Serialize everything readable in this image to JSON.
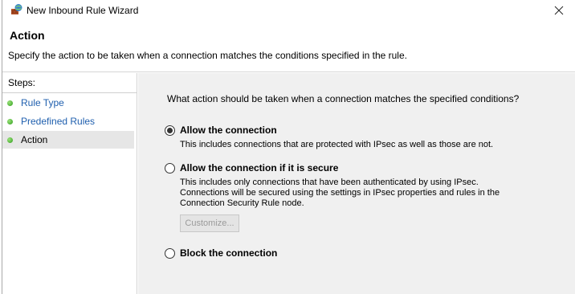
{
  "window": {
    "title": "New Inbound Rule Wizard"
  },
  "header": {
    "title": "Action",
    "description": "Specify the action to be taken when a connection matches the conditions specified in the rule."
  },
  "steps": {
    "label": "Steps:",
    "items": [
      {
        "label": "Rule Type",
        "state": "link"
      },
      {
        "label": "Predefined Rules",
        "state": "link"
      },
      {
        "label": "Action",
        "state": "current"
      }
    ]
  },
  "main": {
    "question": "What action should be taken when a connection matches the specified conditions?",
    "options": [
      {
        "label": "Allow the connection",
        "description": "This includes connections that are protected with IPsec as well as those are not.",
        "checked": true
      },
      {
        "label": "Allow the connection if it is secure",
        "description": "This includes only connections that have been authenticated by using IPsec.  Connections will be secured using the settings in IPsec properties and rules in the Connection Security Rule node.",
        "checked": false
      },
      {
        "label": "Block the connection",
        "description": "",
        "checked": false
      }
    ],
    "customize_label": "Customize..."
  },
  "colors": {
    "link": "#1f5fae",
    "step_dot": "#2f9b1c",
    "content_bg": "#f0f0f0"
  },
  "icons": {
    "app": "firewall-shield-icon",
    "close": "close-icon",
    "step": "green-dot-icon"
  }
}
